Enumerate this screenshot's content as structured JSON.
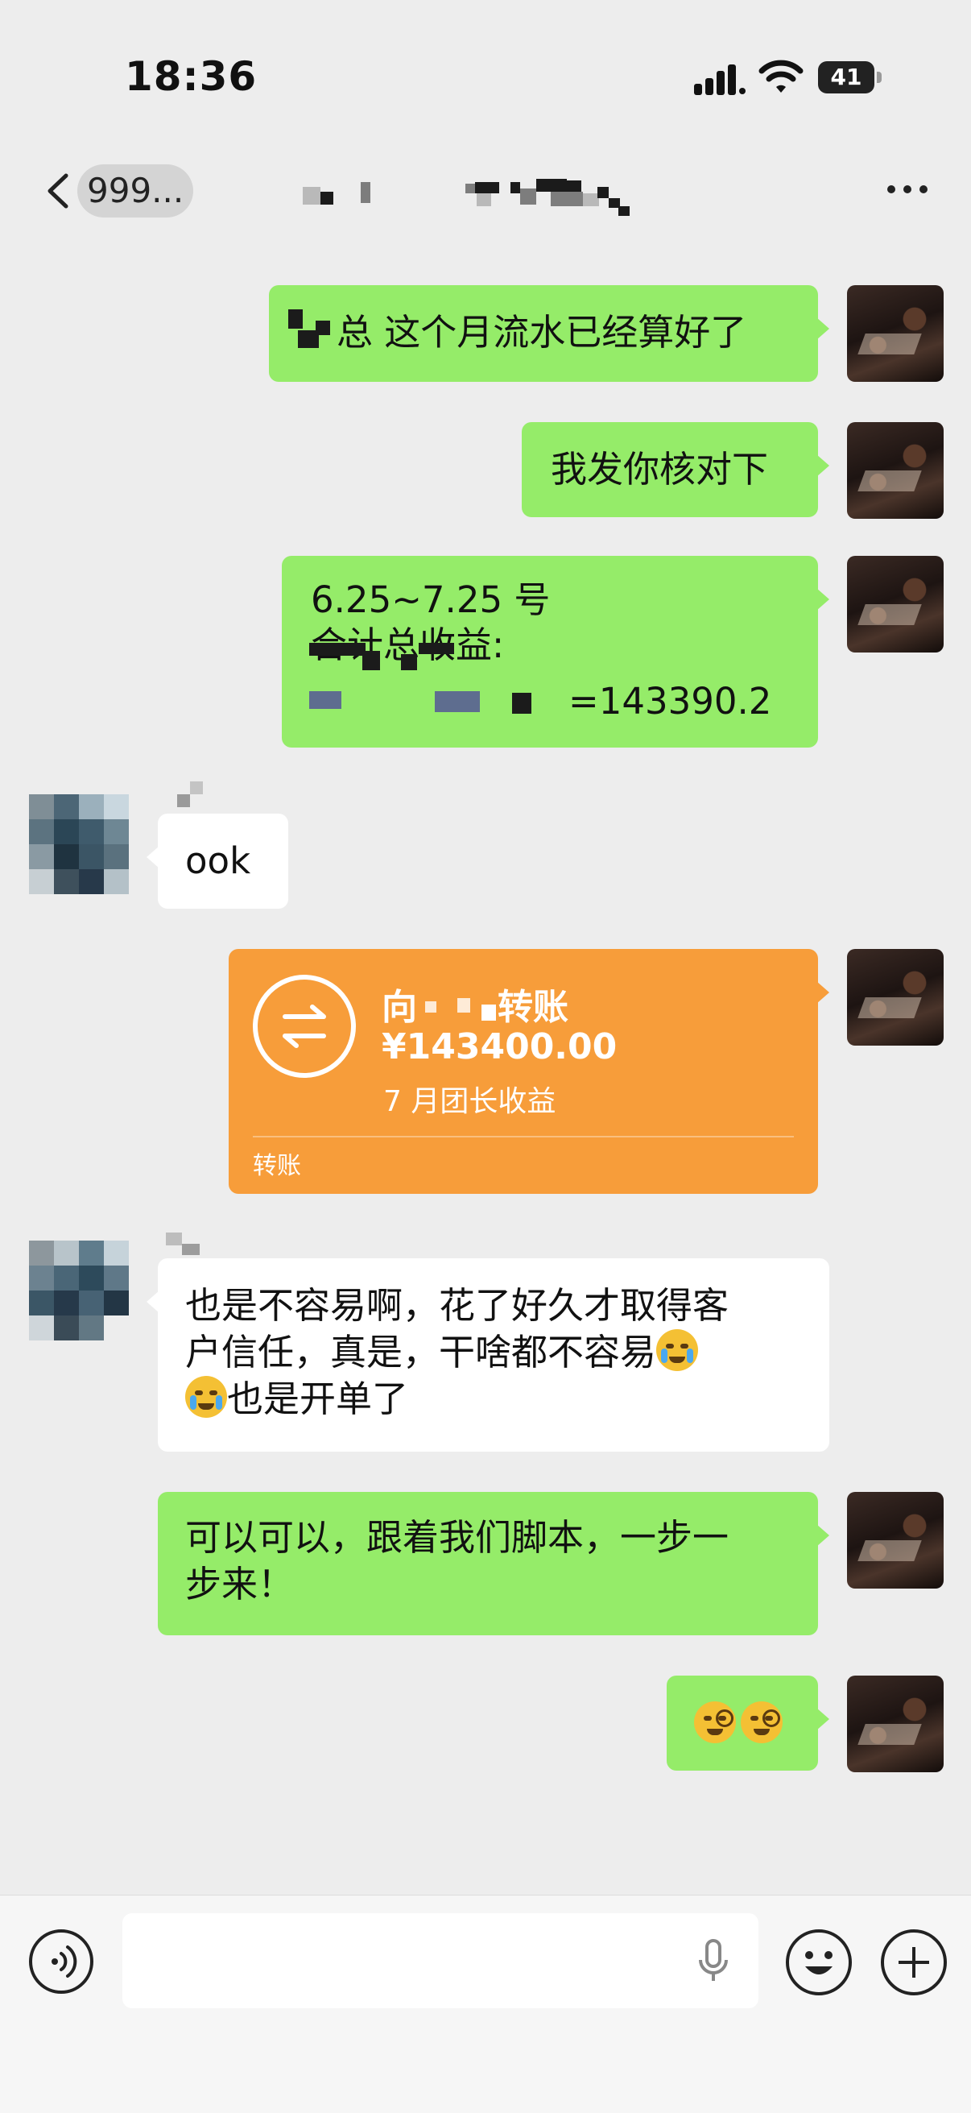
{
  "status_bar": {
    "time": "18:36",
    "battery": "41"
  },
  "nav": {
    "back_label": "999...",
    "title": ""
  },
  "messages": [
    {
      "from": "me",
      "text": "总 这个月流水已经算好了"
    },
    {
      "from": "me",
      "text": "我发你核对下"
    },
    {
      "from": "me",
      "lines": [
        "6.25~7.25 号",
        "合计总收益:",
        "=143390.2"
      ]
    },
    {
      "from": "other",
      "text": "ook"
    },
    {
      "from": "me",
      "type": "transfer",
      "title_prefix": "向",
      "title_suffix": "转账",
      "amount": "¥143400.00",
      "note": "7 月团长收益",
      "type_label": "转账"
    },
    {
      "from": "other",
      "lines": [
        "也是不容易啊，花了好久才取得客",
        "户信任，真是，干啥都不容易",
        "也是开单了"
      ],
      "emojis": [
        "loudly-crying-face",
        "loudly-crying-face"
      ]
    },
    {
      "from": "me",
      "lines": [
        "可以可以，跟着我们脚本，一步一",
        "步来！"
      ]
    },
    {
      "from": "me",
      "emojis": [
        "face-with-monocle",
        "face-with-monocle"
      ]
    }
  ],
  "input": {
    "placeholder": ""
  },
  "colors": {
    "background": "#ededed",
    "my_bubble": "#95ec69",
    "their_bubble": "#ffffff",
    "transfer": "#f79d3a"
  }
}
